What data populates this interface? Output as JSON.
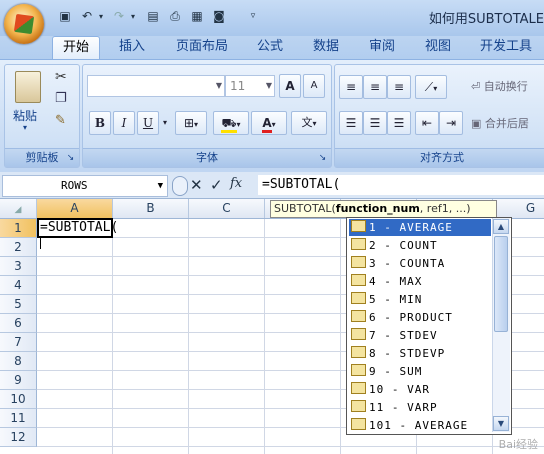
{
  "title": "如何用SUBTOTALE",
  "quick_access": [
    "save-icon",
    "undo-icon",
    "redo-icon",
    "print-preview-icon",
    "print-icon",
    "form-icon",
    "camera-icon",
    "customize-arrow-icon"
  ],
  "tabs": [
    "开始",
    "插入",
    "页面布局",
    "公式",
    "数据",
    "审阅",
    "视图",
    "开发工具"
  ],
  "ribbon": {
    "clipboard": {
      "paste": "粘贴",
      "label": "剪贴板"
    },
    "font": {
      "size": "11",
      "grow": "A",
      "shrink": "A",
      "bold": "B",
      "italic": "I",
      "underline": "U",
      "label": "字体"
    },
    "alignment": {
      "wrap": "自动换行",
      "merge": "合并后居",
      "label": "对齐方式"
    }
  },
  "formula_bar": {
    "name_box": "ROWS",
    "formula": "=SUBTOTAL("
  },
  "columns": [
    "A",
    "B",
    "C",
    "D",
    "E",
    "F",
    "G"
  ],
  "rows": [
    "1",
    "2",
    "3",
    "4",
    "5",
    "6",
    "7",
    "8",
    "9",
    "10",
    "11",
    "12"
  ],
  "cell_a1": "=SUBTOTAL(",
  "tooltip": {
    "func": "SUBTOTAL(",
    "bold": "function_num",
    "rest": ", ref1, ...)"
  },
  "functions": [
    "1 - AVERAGE",
    "2 - COUNT",
    "3 - COUNTA",
    "4 - MAX",
    "5 - MIN",
    "6 - PRODUCT",
    "7 - STDEV",
    "8 - STDEVP",
    "9 - SUM",
    "10 - VAR",
    "11 - VARP",
    "101 - AVERAGE"
  ],
  "selected_function": "1 - AVERAGE",
  "watermark": "Bai经验"
}
